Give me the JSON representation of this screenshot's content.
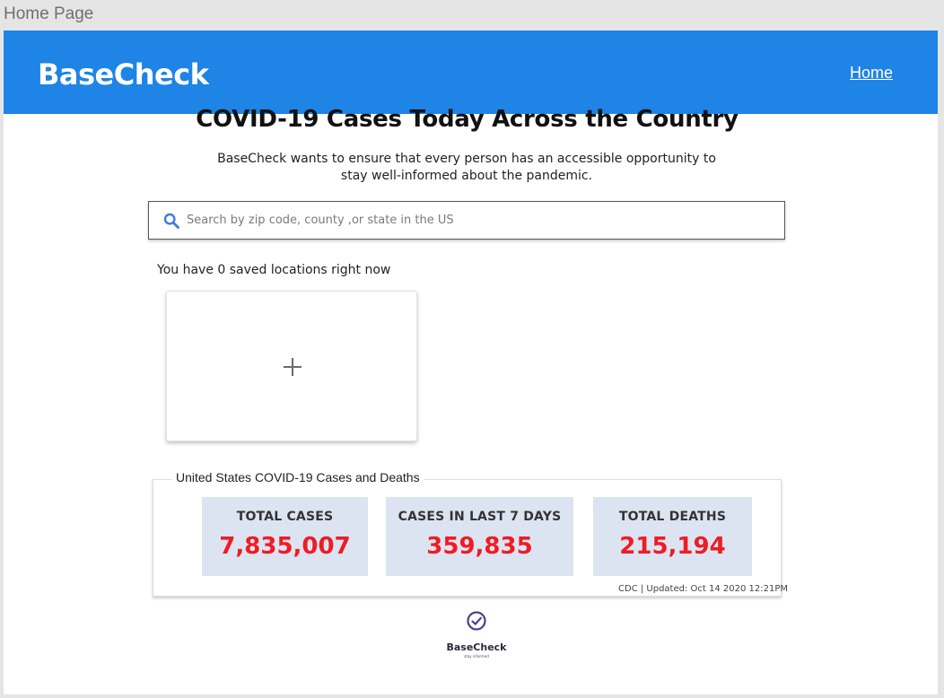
{
  "frame": {
    "label": "Home Page"
  },
  "header": {
    "brand": "BaseCheck",
    "nav_home": "Home"
  },
  "main": {
    "title": "COVID-19 Cases Today Across the Country",
    "subtitle": "BaseCheck wants to ensure that every person has an accessible opportunity to stay well-informed about the pandemic.",
    "search": {
      "placeholder": "Search by zip code, county ,or state in the US",
      "value": ""
    },
    "saved_locations_text": "You have 0 saved locations right now",
    "add_location_icon": "plus-icon"
  },
  "stats": {
    "legend": "United States COVID-19 Cases and Deaths",
    "total_cases": {
      "label": "TOTAL CASES",
      "value": "7,835,007"
    },
    "last_7_days": {
      "label": "CASES IN LAST 7 DAYS",
      "value": "359,835"
    },
    "total_deaths": {
      "label": "TOTAL DEATHS",
      "value": "215,194"
    },
    "update_note": "CDC | Updated: Oct 14 2020 12:21PM"
  },
  "footer": {
    "brand": "BaseCheck",
    "tagline": "stay informed",
    "icon": "check-circle-icon"
  },
  "colors": {
    "header_bg": "#1e84e6",
    "stat_bg": "#dce4f2",
    "stat_value": "#ee1c24",
    "search_icon": "#3d7de0"
  }
}
